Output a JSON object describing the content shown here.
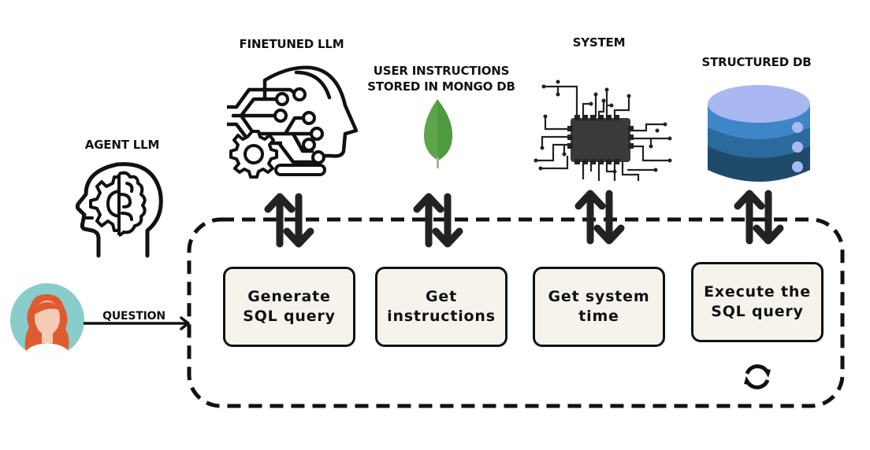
{
  "nodes": {
    "agent_llm": {
      "label": "AGENT LLM",
      "icon": "head-gear-brain-icon"
    },
    "finetuned_llm": {
      "label": "FINETUNED LLM",
      "icon": "head-circuit-gear-icon"
    },
    "mongo": {
      "label": "USER INSTRUCTIONS\nSTORED IN MONGO DB",
      "icon": "mongodb-leaf-icon"
    },
    "system": {
      "label": "SYSTEM",
      "icon": "cpu-chip-icon"
    },
    "structured_db": {
      "label": "STRUCTURED DB",
      "icon": "database-icon"
    },
    "user": {
      "icon": "user-avatar-icon"
    }
  },
  "edges": {
    "question": {
      "label": "QUESTION",
      "from": "user",
      "to": "agent-loop"
    }
  },
  "tools": [
    {
      "label": "Generate\nSQL query",
      "connects_to": "finetuned_llm"
    },
    {
      "label": "Get\ninstructions",
      "connects_to": "mongo"
    },
    {
      "label": "Get system\ntime",
      "connects_to": "system"
    },
    {
      "label": "Execute the\nSQL query",
      "connects_to": "structured_db"
    }
  ],
  "loop": {
    "icon": "refresh-cycle-icon"
  },
  "colors": {
    "box_fill": "#f5f3ec",
    "stroke": "#111111",
    "avatar_bg": "#88cccb",
    "hair": "#e05a2f",
    "skin": "#f4cbb5",
    "leaf": "#5da54d",
    "db_top": "#a9b8f1",
    "db_layer1": "#3f86c9",
    "db_layer2": "#2b6a9c",
    "db_layer3": "#1f4a6a"
  }
}
